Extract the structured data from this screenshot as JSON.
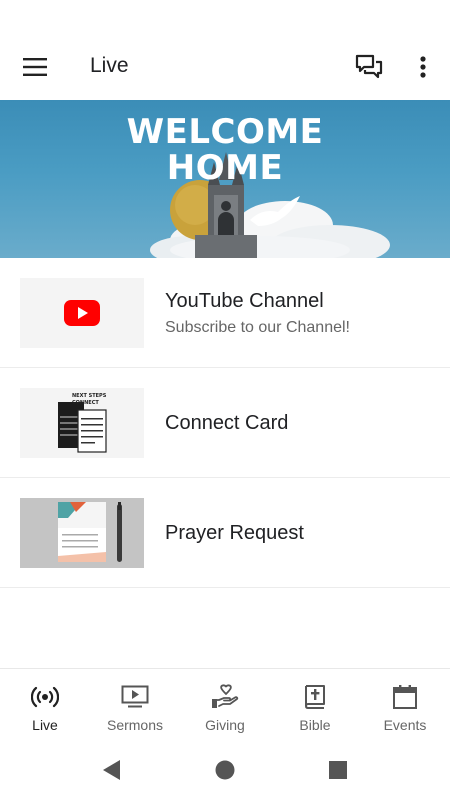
{
  "app_bar": {
    "title": "Live",
    "menu_icon": "hamburger-menu-icon",
    "chat_icon": "chat-bubbles-icon",
    "more_icon": "more-vertical-icon"
  },
  "hero": {
    "title_line1": "WELCOME",
    "title_line2": "HOME"
  },
  "items": [
    {
      "title": "YouTube Channel",
      "subtitle": "Subscribe to our Channel!",
      "thumb": "youtube-logo"
    },
    {
      "title": "Connect Card",
      "subtitle": "",
      "thumb": "next-steps-connect-card",
      "thumb_text_1": "NEXT STEPS",
      "thumb_text_2": "CONNECT"
    },
    {
      "title": "Prayer Request",
      "subtitle": "",
      "thumb": "prayer-cards"
    }
  ],
  "bottom_nav": [
    {
      "label": "Live",
      "icon": "live-broadcast-icon",
      "active": true
    },
    {
      "label": "Sermons",
      "icon": "video-screen-icon",
      "active": false
    },
    {
      "label": "Giving",
      "icon": "heart-in-hand-icon",
      "active": false
    },
    {
      "label": "Bible",
      "icon": "bible-book-icon",
      "active": false
    },
    {
      "label": "Events",
      "icon": "calendar-icon",
      "active": false
    }
  ],
  "colors": {
    "youtube_red": "#ff0000",
    "hero_blue": "#3b8db7",
    "active_text": "#222222",
    "inactive_text": "#666666"
  }
}
